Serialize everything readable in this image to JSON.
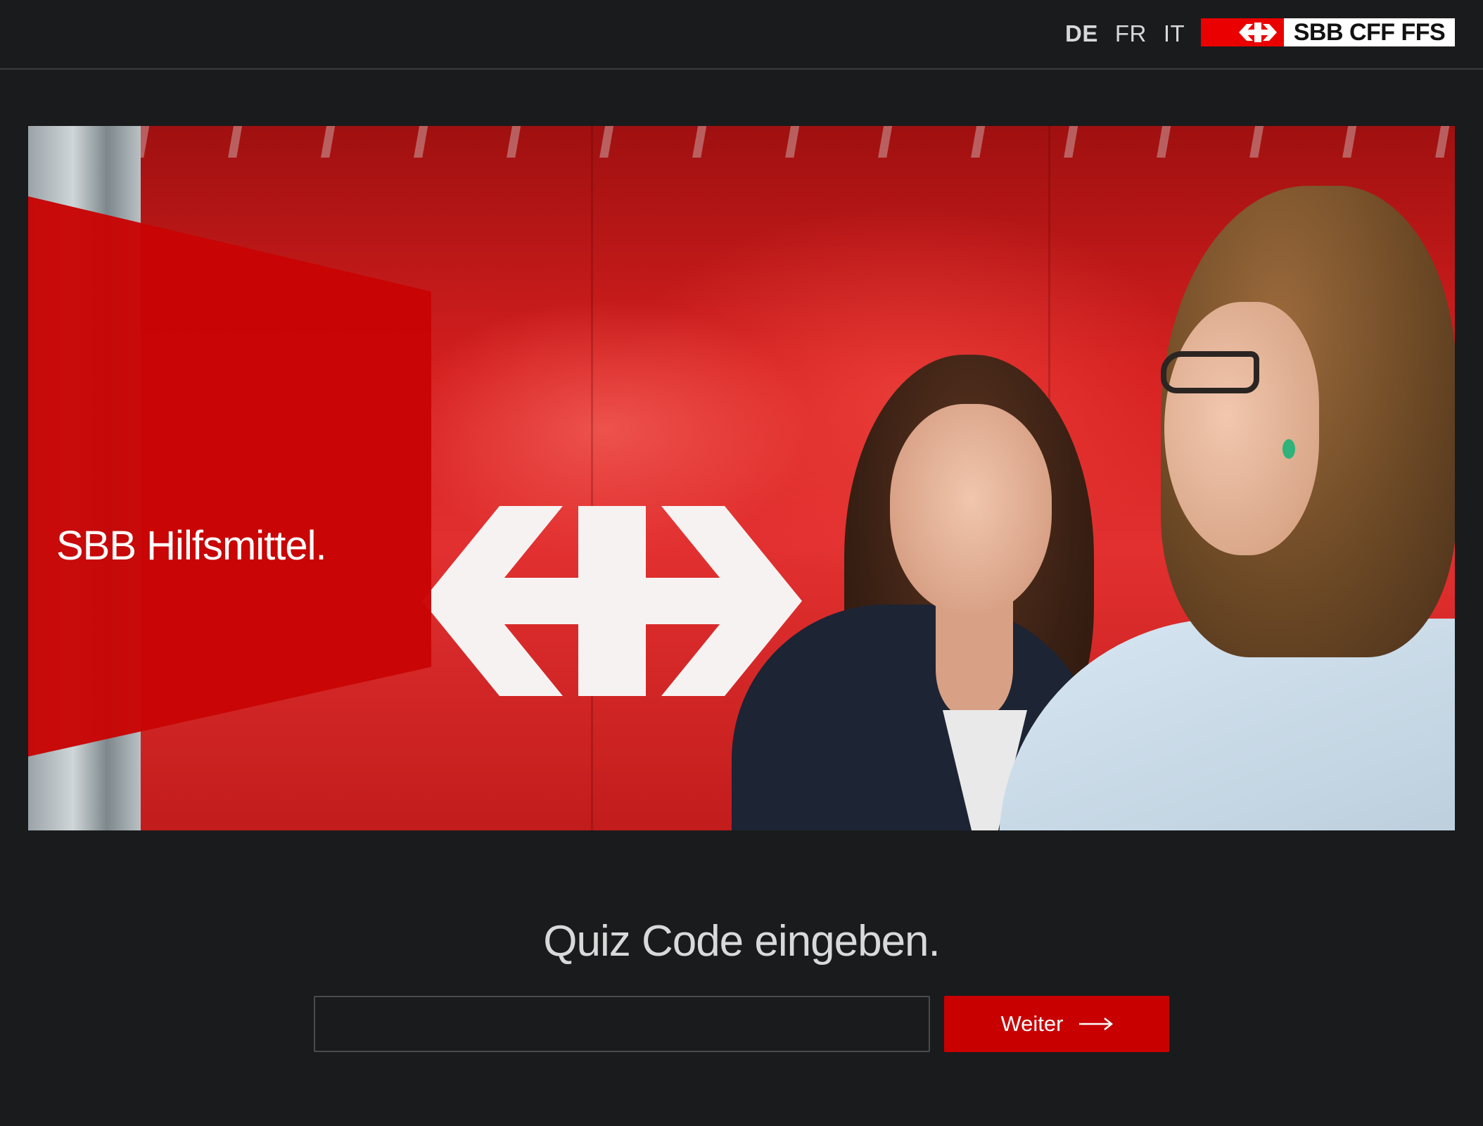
{
  "header": {
    "languages": [
      {
        "code": "DE",
        "active": true
      },
      {
        "code": "FR",
        "active": false
      },
      {
        "code": "IT",
        "active": false
      }
    ],
    "logo": {
      "wordmark": "SBB CFF FFS",
      "icon": "sbb-arrows-icon",
      "flag_color": "#eb0000"
    }
  },
  "hero": {
    "title": "SBB Hilfsmittel.",
    "panel_color": "#c80404"
  },
  "quiz": {
    "heading": "Quiz Code eingeben.",
    "input_value": "",
    "input_placeholder": "",
    "button_label": "Weiter",
    "button_icon": "arrow-right-icon",
    "button_color": "#c80000"
  },
  "colors": {
    "background": "#1a1b1d",
    "divider": "#3b3c3f",
    "text": "#d9d9d9"
  }
}
